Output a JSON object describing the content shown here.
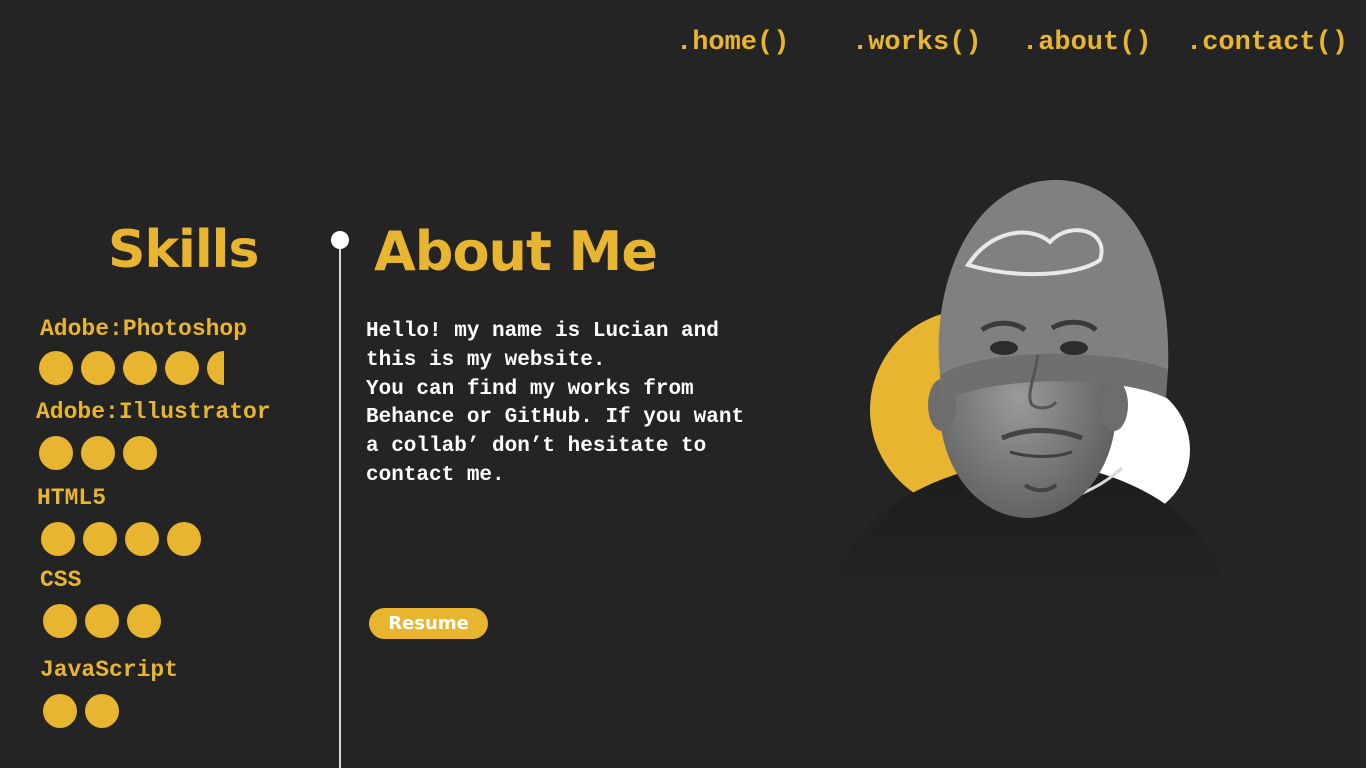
{
  "nav": {
    "home": ".home()",
    "works": ".works()",
    "about": ".about()",
    "contact": ".contact()"
  },
  "skills": {
    "title": "Skills",
    "items": [
      {
        "name": "Adobe:Photoshop",
        "level": 4.5
      },
      {
        "name": "Adobe:Illustrator",
        "level": 3
      },
      {
        "name": "HTML5",
        "level": 4
      },
      {
        "name": "CSS",
        "level": 3
      },
      {
        "name": "JavaScript",
        "level": 2
      }
    ]
  },
  "about": {
    "title": "About Me",
    "lines": [
      "Hello! my name is Lucian and",
      "this is my website.",
      "You can find my works from",
      "Behance or GitHub. If you want",
      "a collab’ don’t hesitate to",
      "contact me."
    ],
    "resume_label": "Resume"
  },
  "colors": {
    "background": "#252424",
    "accent": "#e8b531",
    "text": "#ffffff"
  },
  "icons": {
    "timeline_marker": "timeline-dot-icon"
  }
}
